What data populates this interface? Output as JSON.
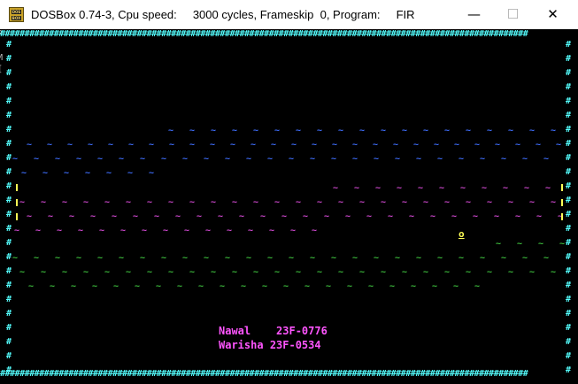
{
  "window": {
    "title": "DOSBox 0.74-3, Cpu speed:     3000 cycles, Frameskip  0, Program:     FIR",
    "icon_label_top": "DOS",
    "icon_label_bottom": "BOX",
    "minimize_glyph": "—",
    "maximize_glyph": "☐",
    "close_glyph": "✕"
  },
  "game": {
    "wall_char": "#",
    "player_char": "o",
    "credits": [
      {
        "name": "Nawal  ",
        "id": "23F-0776"
      },
      {
        "name": "Warisha",
        "id": "23F-0534"
      }
    ]
  },
  "colors": {
    "wall": "#55ffff",
    "lane_top": "#3f6fff",
    "lane_middle": "#d44ad4",
    "lane_bottom": "#3ec03e",
    "player": "#ffff55",
    "credits": "#ff55ff"
  }
}
